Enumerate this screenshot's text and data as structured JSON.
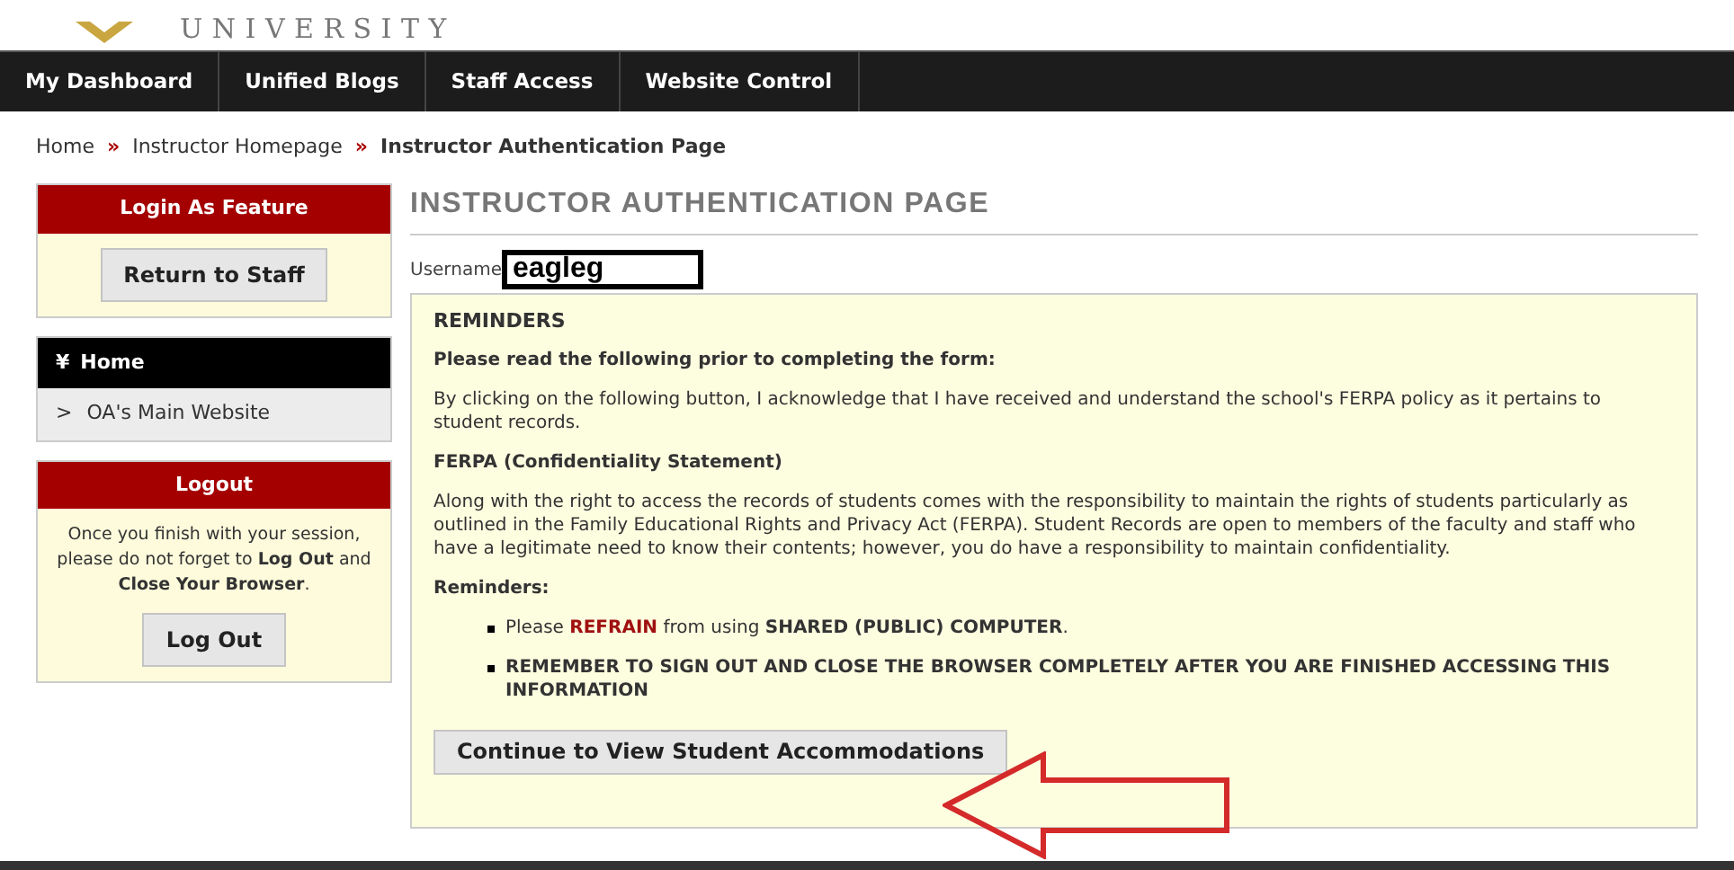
{
  "logo": {
    "wordmark": "UNIVERSITY"
  },
  "nav": [
    {
      "label": "My Dashboard"
    },
    {
      "label": "Unified Blogs"
    },
    {
      "label": "Staff Access"
    },
    {
      "label": "Website Control"
    }
  ],
  "breadcrumb": [
    {
      "label": "Home",
      "current": false
    },
    {
      "label": "Instructor Homepage",
      "current": false
    },
    {
      "label": "Instructor Authentication Page",
      "current": true
    }
  ],
  "breadcrumb_separator": "»",
  "sidebar": {
    "login_as": {
      "title": "Login As Feature",
      "button": "Return to Staff"
    },
    "menu": {
      "header_icon": "¥",
      "header": "Home",
      "items": [
        {
          "icon": ">",
          "label": "OA's Main Website"
        }
      ]
    },
    "logout": {
      "title": "Logout",
      "text": "Once you finish with your session, please do not forget to **Log Out** and **Close Your Browser**.",
      "button": "Log Out"
    }
  },
  "page_title": "INSTRUCTOR AUTHENTICATION PAGE",
  "username": {
    "label": "Username",
    "value": "eagleg"
  },
  "reminders": {
    "title": "REMINDERS",
    "intro": "Please read the following prior to completing the form:",
    "ack": "By clicking on the following button, I acknowledge that I have received and understand the school's FERPA policy as it pertains to student records.",
    "ferpa_title": "FERPA (Confidentiality Statement)",
    "ferpa_text": "Along with the right to access the records of students comes with the responsibility to maintain the rights of students particularly as outlined in the Family Educational Rights and Privacy Act (FERPA). Student Records are open to members of the faculty and staff who have a legitimate need to know their contents; however, you do have a responsibility to maintain confidentiality.",
    "list_title": "Reminders:",
    "bullets": [
      [
        {
          "text": "Please ",
          "kind": "plain"
        },
        {
          "text": "REFRAIN",
          "kind": "alert"
        },
        {
          "text": " from using ",
          "kind": "plain"
        },
        {
          "text": "SHARED (PUBLIC) COMPUTER",
          "kind": "bold"
        },
        {
          "text": ".",
          "kind": "plain"
        }
      ],
      [
        {
          "text": "REMEMBER TO SIGN OUT AND CLOSE THE BROWSER COMPLETELY AFTER YOU ARE FINISHED ACCESSING THIS INFORMATION",
          "kind": "bold"
        }
      ]
    ],
    "button": "Continue to View Student Accommodations"
  },
  "annotation": {
    "kind": "arrow"
  }
}
